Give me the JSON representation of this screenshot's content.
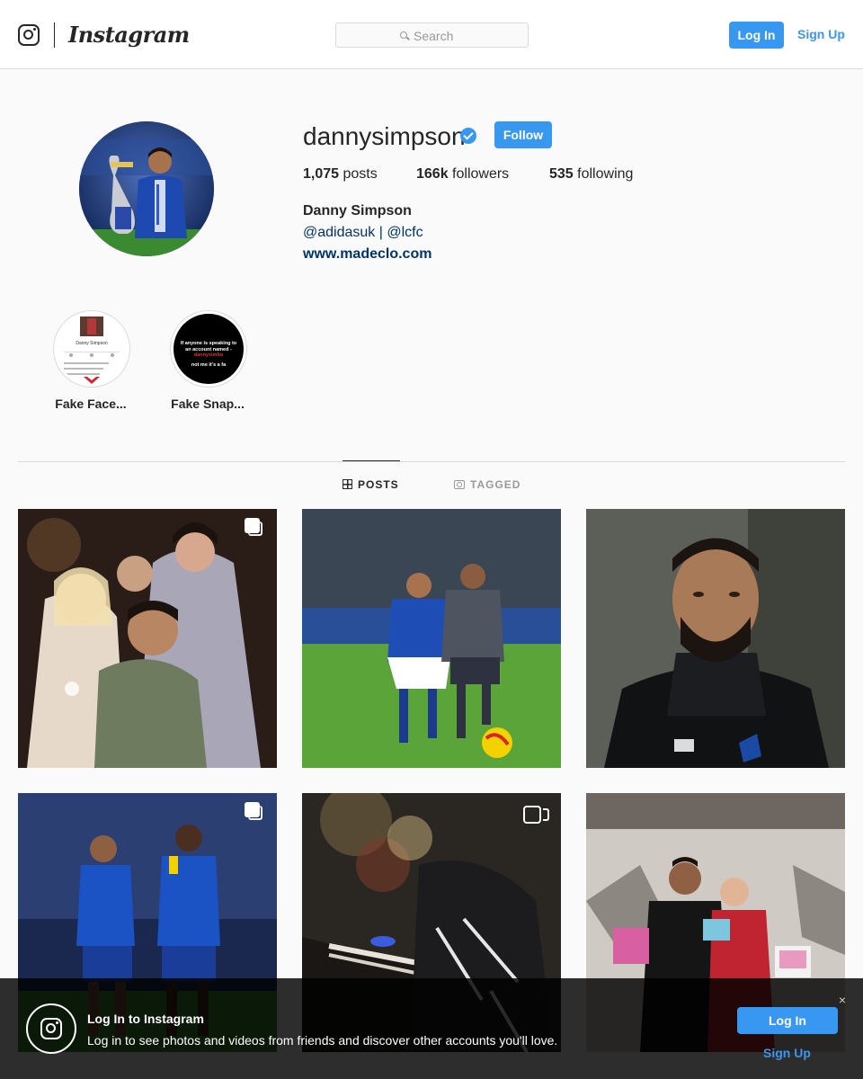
{
  "header": {
    "wordmark": "Instagram",
    "search_placeholder": "Search",
    "login_label": "Log In",
    "signup_label": "Sign Up"
  },
  "profile": {
    "username": "dannysimpson",
    "verified": true,
    "follow_label": "Follow",
    "posts_count": "1,075",
    "posts_label": "posts",
    "followers_count": "166k",
    "followers_label": "followers",
    "following_count": "535",
    "following_label": "following",
    "full_name": "Danny Simpson",
    "bio": "@adidasuk | @lcfc",
    "website": "www.madeclo.com"
  },
  "highlights": [
    {
      "label": "Fake Face..."
    },
    {
      "label": "Fake Snap..."
    }
  ],
  "highlight_previews": {
    "first_name": "Danny Simpson",
    "second_text": "If anyone is speaking to an account named -",
    "second_handle": "dannysimbo",
    "second_footer": "not me it's a fa"
  },
  "tabs": [
    {
      "label": "POSTS",
      "active": true
    },
    {
      "label": "TAGGED",
      "active": false
    }
  ],
  "posts": [
    {
      "type": "carousel",
      "icon": "multiple-photos-icon"
    },
    {
      "type": "photo"
    },
    {
      "type": "photo"
    },
    {
      "type": "carousel",
      "icon": "multiple-photos-icon"
    },
    {
      "type": "video",
      "icon": "video-icon"
    },
    {
      "type": "photo"
    }
  ],
  "login_banner": {
    "title": "Log In to Instagram",
    "text": "Log in to see photos and videos from friends and discover other accounts you'll love.",
    "login_label": "Log In",
    "signup_label": "Sign Up",
    "close_label": "×"
  },
  "colors": {
    "accent": "#3897f0",
    "link_dark": "#003569",
    "text": "#262626",
    "border": "#dbdbdb",
    "background": "#fafafa"
  }
}
